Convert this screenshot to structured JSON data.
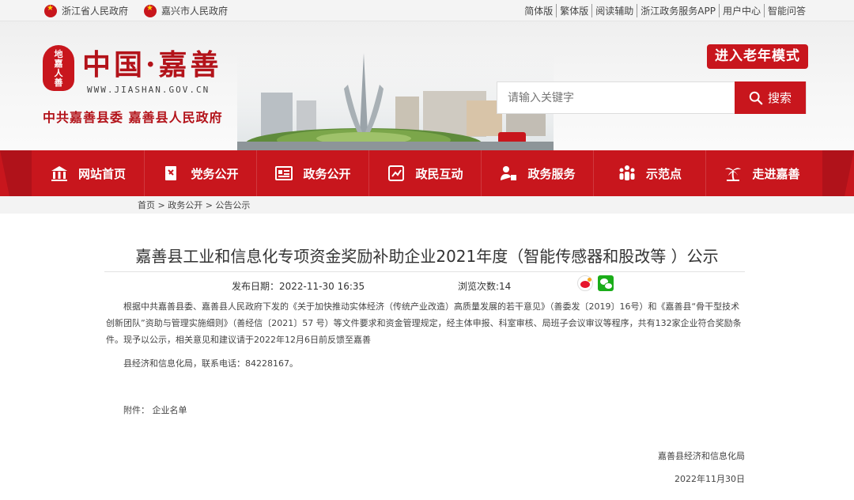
{
  "topbar": {
    "left_links": [
      "浙江省人民政府",
      "嘉兴市人民政府"
    ],
    "right_links": [
      "简体版",
      "繁体版",
      "阅读辅助",
      "浙江政务服务APP",
      "用户中心",
      "智能问答"
    ]
  },
  "header": {
    "seal_text": "地嘉人善",
    "site_title": "中国·嘉善",
    "site_url": "WWW.JIASHAN.GOV.CN",
    "subtitle": "中共嘉善县委  嘉善县人民政府",
    "elder_mode": "进入老年模式",
    "search": {
      "placeholder": "请输入关键字",
      "button": "搜索"
    }
  },
  "nav": [
    {
      "label": "网站首页",
      "icon": "home-icon"
    },
    {
      "label": "党务公开",
      "icon": "party-flag-icon"
    },
    {
      "label": "政务公开",
      "icon": "document-icon"
    },
    {
      "label": "政民互动",
      "icon": "chat-icon"
    },
    {
      "label": "政务服务",
      "icon": "service-icon"
    },
    {
      "label": "示范点",
      "icon": "people-icon"
    },
    {
      "label": "走进嘉善",
      "icon": "palm-tree-icon"
    }
  ],
  "breadcrumb": "首页 > 政务公开 > 公告公示",
  "article": {
    "title": "嘉善县工业和信息化专项资金奖励补助企业2021年度（智能传感器和股改等 ）公示",
    "publish_label": "发布日期：",
    "publish_date": "2022-11-30 16:35",
    "views_label": "浏览次数:",
    "views": "14",
    "paragraph1": "根据中共嘉善县委、嘉善县人民政府下发的《关于加快推动实体经济（传统产业改造）高质量发展的若干意见》（善委发〔2019〕16号）和《嘉善县“骨干型技术创新团队”资助与管理实施细则》（善经信〔2021〕57 号）等文件要求和资金管理规定，经主体申报、科室审核、局班子会议审议等程序，共有132家企业符合奖励条件。现予以公示，相关意见和建议请于2022年12月6日前反馈至嘉善",
    "paragraph2": "县经济和信息化局，联系电话：84228167。",
    "attachment": "附件：  企业名单",
    "signature_org": "嘉善县经济和信息化局",
    "signature_date": "2022年11月30日"
  },
  "colors": {
    "brand_red": "#c8161d",
    "nav_red": "#c8161d"
  }
}
